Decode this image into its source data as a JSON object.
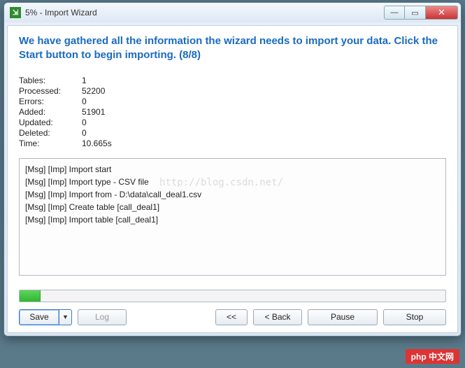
{
  "window": {
    "title": "5% - Import Wizard"
  },
  "heading": "We have gathered all the information the wizard needs to import your data. Click the Start button to begin importing. (8/8)",
  "stats": {
    "tables_label": "Tables:",
    "tables_value": "1",
    "processed_label": "Processed:",
    "processed_value": "52200",
    "errors_label": "Errors:",
    "errors_value": "0",
    "added_label": "Added:",
    "added_value": "51901",
    "updated_label": "Updated:",
    "updated_value": "0",
    "deleted_label": "Deleted:",
    "deleted_value": "0",
    "time_label": "Time:",
    "time_value": "10.665s"
  },
  "log": [
    "[Msg] [Imp] Import start",
    "[Msg] [Imp] Import type - CSV file",
    "[Msg] [Imp] Import from - D:\\data\\call_deal1.csv",
    "[Msg] [Imp] Create table [call_deal1]",
    "[Msg] [Imp] Import table [call_deal1]"
  ],
  "progress": {
    "percent": 5
  },
  "buttons": {
    "save": "Save",
    "log": "Log",
    "first": "<<",
    "back": "< Back",
    "pause": "Pause",
    "stop": "Stop"
  },
  "watermarks": {
    "url": "http://blog.csdn.net/",
    "brand": "php 中文网"
  }
}
